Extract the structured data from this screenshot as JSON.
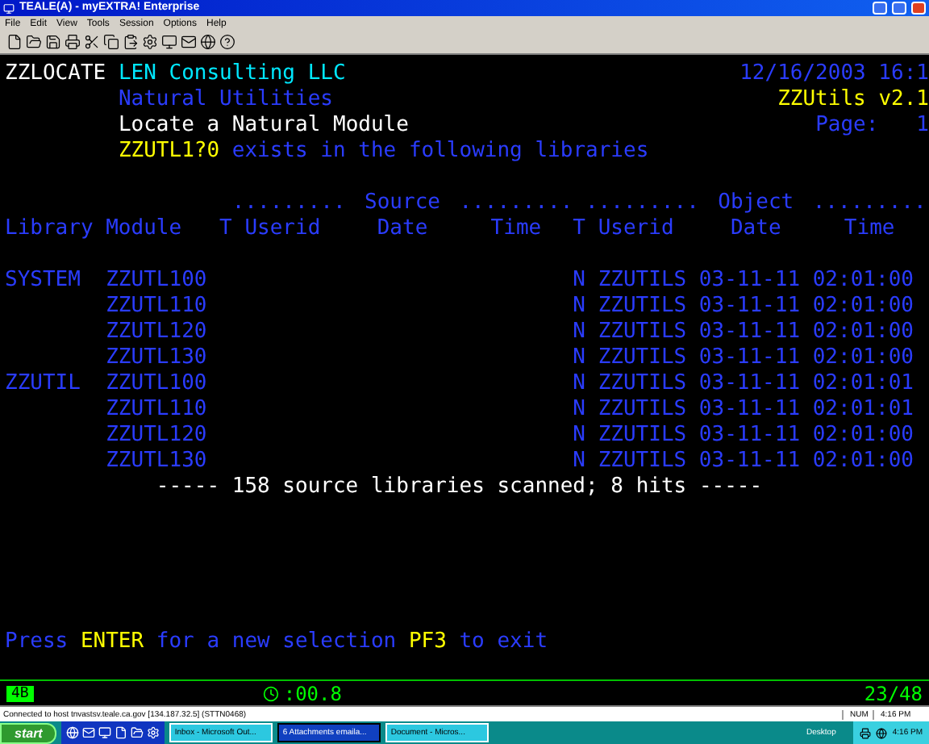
{
  "window": {
    "title": "TEALE(A) - myEXTRA! Enterprise"
  },
  "menu": [
    "File",
    "Edit",
    "View",
    "Tools",
    "Session",
    "Options",
    "Help"
  ],
  "screen": {
    "program": "ZZLOCATE",
    "company": "LEN Consulting LLC",
    "datetime": "12/16/2003 16:1",
    "subtitle": "Natural Utilities",
    "version": "ZZUtils v2.1",
    "title": "Locate a Natural Module",
    "page_label": "Page:",
    "page": "1",
    "module_pattern": "ZZUTL1?0",
    "message": "exists in the following libraries",
    "groups": [
      {
        "label": "Source",
        "dots_left": ".........",
        "dots_right": "........."
      },
      {
        "label": "Object",
        "dots_left": ".........",
        "dots_right": "........."
      }
    ],
    "columns": [
      "Library",
      "Module",
      "T",
      "Userid",
      "Date",
      "Time",
      "T",
      "Userid",
      "Date",
      "Time"
    ],
    "rows": [
      {
        "library": "SYSTEM",
        "module": "ZZUTL100",
        "object_type": "N",
        "object_userid": "ZZUTILS",
        "object_date": "03-11-11",
        "object_time": "02:01:00"
      },
      {
        "module": "ZZUTL110",
        "object_type": "N",
        "object_userid": "ZZUTILS",
        "object_date": "03-11-11",
        "object_time": "02:01:00"
      },
      {
        "module": "ZZUTL120",
        "object_type": "N",
        "object_userid": "ZZUTILS",
        "object_date": "03-11-11",
        "object_time": "02:01:00"
      },
      {
        "module": "ZZUTL130",
        "object_type": "N",
        "object_userid": "ZZUTILS",
        "object_date": "03-11-11",
        "object_time": "02:01:00"
      },
      {
        "library": "ZZUTIL",
        "module": "ZZUTL100",
        "object_type": "N",
        "object_userid": "ZZUTILS",
        "object_date": "03-11-11",
        "object_time": "02:01:01"
      },
      {
        "module": "ZZUTL110",
        "object_type": "N",
        "object_userid": "ZZUTILS",
        "object_date": "03-11-11",
        "object_time": "02:01:01"
      },
      {
        "module": "ZZUTL120",
        "object_type": "N",
        "object_userid": "ZZUTILS",
        "object_date": "03-11-11",
        "object_time": "02:01:00"
      },
      {
        "module": "ZZUTL130",
        "object_type": "N",
        "object_userid": "ZZUTILS",
        "object_date": "03-11-11",
        "object_time": "02:01:00"
      }
    ],
    "summary": "----- 158 source libraries scanned; 8 hits -----",
    "footer": [
      {
        "text": "Press",
        "kind": "text"
      },
      {
        "text": "ENTER",
        "kind": "key"
      },
      {
        "text": "for a new selection",
        "kind": "text"
      },
      {
        "text": "PF3",
        "kind": "key"
      },
      {
        "text": "to exit",
        "kind": "text"
      }
    ]
  },
  "oia": {
    "indicator": "4B",
    "timer": ":00.8",
    "cursor": "23/48"
  },
  "status_bar": {
    "message": "Connected to host tnvastsv.teale.ca.gov [134.187.32.5] (STTN0468)",
    "num": "NUM",
    "time": "4:16 PM"
  },
  "taskbar": {
    "start": "start",
    "tasks": [
      {
        "label": "Inbox - Microsoft Out...",
        "selected": false
      },
      {
        "label": "6 Attachments emaila...",
        "selected": true
      },
      {
        "label": "Document - Micros...",
        "selected": false
      }
    ],
    "address": "Desktop",
    "clock": "4:16 PM"
  }
}
